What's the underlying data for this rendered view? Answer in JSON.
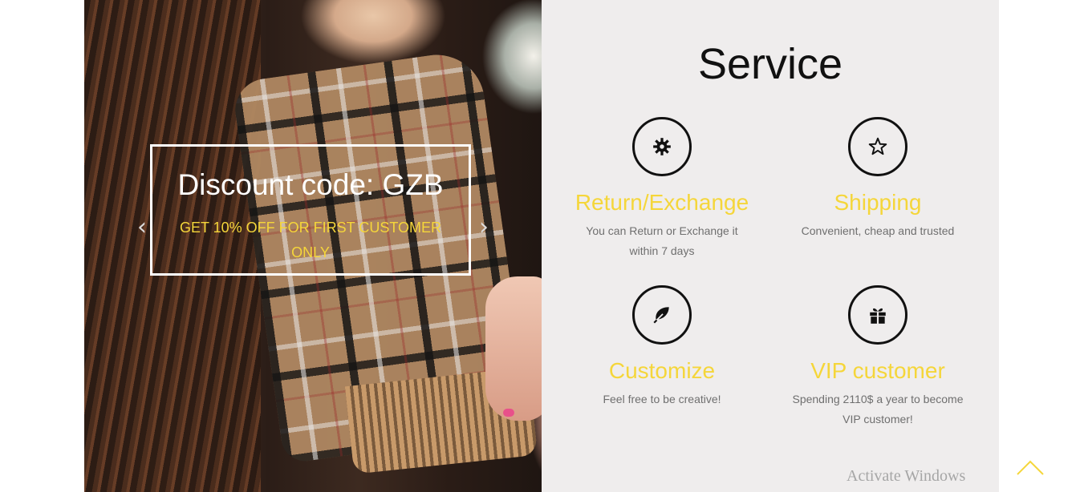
{
  "hero": {
    "caption_title": "Discount code: GZB",
    "caption_subtitle": "GET 10% OFF FOR FIRST CUSTOMER ONLY",
    "prev_arrow": "‹",
    "next_arrow": "›"
  },
  "service": {
    "title": "Service",
    "items": [
      {
        "icon": "gear-icon",
        "title": "Return/Exchange",
        "desc": "You can Return or Exchange it within 7 days"
      },
      {
        "icon": "star-icon",
        "title": "Shipping",
        "desc": "Convenient, cheap and trusted"
      },
      {
        "icon": "leaf-icon",
        "title": "Customize",
        "desc": "Feel free to be creative!"
      },
      {
        "icon": "gift-icon",
        "title": "VIP customer",
        "desc": "Spending 2110$ a year to become VIP customer!"
      }
    ]
  },
  "overlay": {
    "watermark": "Activate Windows"
  },
  "colors": {
    "accent": "#f5d63a",
    "panel_bg": "#efeded",
    "text_dark": "#111111",
    "text_muted": "#6f6f6f"
  }
}
